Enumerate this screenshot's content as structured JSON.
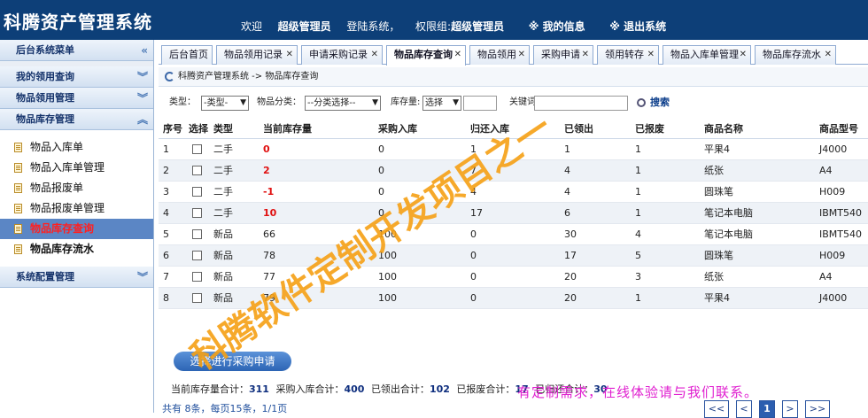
{
  "app": {
    "title": "科腾资产管理系统",
    "welcome": "欢迎",
    "user": "超级管理员",
    "login_text": "登陆系统，",
    "perm_label": "权限组:",
    "perm_value": "超级管理员",
    "my_info": "※ 我的信息",
    "logout": "※ 退出系统"
  },
  "sidebar": {
    "top_menu": "后台系统菜单",
    "groups": [
      {
        "label": "我的领用查询"
      },
      {
        "label": "物品领用管理"
      },
      {
        "label": "物品库存管理"
      },
      {
        "label": "系统配置管理"
      }
    ],
    "items": [
      {
        "label": "物品入库单"
      },
      {
        "label": "物品入库单管理"
      },
      {
        "label": "物品报废单"
      },
      {
        "label": "物品报废单管理"
      },
      {
        "label": "物品库存查询"
      },
      {
        "label": "物品库存流水"
      }
    ]
  },
  "tabs": [
    {
      "label": "后台首页"
    },
    {
      "label": "物品领用记录"
    },
    {
      "label": "申请采购记录"
    },
    {
      "label": "物品库存查询"
    },
    {
      "label": "物品领用"
    },
    {
      "label": "采购申请"
    },
    {
      "label": "领用转存"
    },
    {
      "label": "物品入库单管理"
    },
    {
      "label": "物品库存流水"
    }
  ],
  "breadcrumb": "科腾资产管理系统 -> 物品库存查询",
  "filter": {
    "type_label": "类型：",
    "type_value": "-类型-",
    "category_label": "物品分类：",
    "category_value": "--分类选择--",
    "stock_label": "库存量:",
    "stock_value": "选择",
    "keyword_label": "关键词",
    "search": "搜索"
  },
  "table": {
    "headers": [
      "序号",
      "选择",
      "类型",
      "当前库存量",
      "采购入库",
      "归还入库",
      "已领出",
      "已报废",
      "商品名称",
      "商品型号"
    ],
    "rows": [
      [
        "1",
        "",
        "二手",
        "0",
        "0",
        "1",
        "1",
        "1",
        "平果4",
        "J4000"
      ],
      [
        "2",
        "",
        "二手",
        "2",
        "0",
        "7",
        "4",
        "1",
        "纸张",
        "A4"
      ],
      [
        "3",
        "",
        "二手",
        "-1",
        "0",
        "4",
        "4",
        "1",
        "圆珠笔",
        "H009"
      ],
      [
        "4",
        "",
        "二手",
        "10",
        "0",
        "17",
        "6",
        "1",
        "笔记本电脑",
        "IBMT540"
      ],
      [
        "5",
        "",
        "新品",
        "66",
        "100",
        "0",
        "30",
        "4",
        "笔记本电脑",
        "IBMT540"
      ],
      [
        "6",
        "",
        "新品",
        "78",
        "100",
        "0",
        "17",
        "5",
        "圆珠笔",
        "H009"
      ],
      [
        "7",
        "",
        "新品",
        "77",
        "100",
        "0",
        "20",
        "3",
        "纸张",
        "A4"
      ],
      [
        "8",
        "",
        "新品",
        "79",
        "100",
        "0",
        "20",
        "1",
        "平果4",
        "J4000"
      ]
    ]
  },
  "action_button": "选择进行采购申请",
  "totals": {
    "stock_label": "当前库存量合计：",
    "stock": "311",
    "purchase_label": "采购入库合计：",
    "purchase": "400",
    "out_label": "已领出合计：",
    "out": "102",
    "scrap_label": "已报废合计：",
    "scrap": "17",
    "return_label": "已归还合计：",
    "return": "30"
  },
  "pagination": {
    "info": "共有 8条，每页15条，1/1页",
    "first": "<<",
    "prev": "<",
    "current": "1",
    "next": ">",
    "last": ">>"
  },
  "watermark": {
    "line1": "科腾软件定制开发项目之一",
    "contact": "有定制需求，在线体验请与我们联系。"
  }
}
